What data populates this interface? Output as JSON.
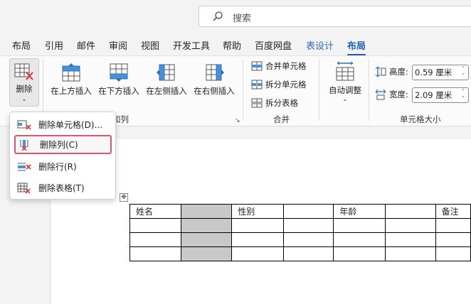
{
  "search": {
    "placeholder": "搜索"
  },
  "tabs": [
    {
      "label": "布局"
    },
    {
      "label": "引用"
    },
    {
      "label": "邮件"
    },
    {
      "label": "审阅"
    },
    {
      "label": "视图"
    },
    {
      "label": "开发工具"
    },
    {
      "label": "帮助"
    },
    {
      "label": "百度网盘"
    },
    {
      "label": "表设计"
    },
    {
      "label": "布局"
    }
  ],
  "ribbon": {
    "delete_label": "删除",
    "insert_above": "在上方插入",
    "insert_below": "在下方插入",
    "insert_left": "在左侧插入",
    "insert_right": "在右侧插入",
    "rows_cols_group_partial": "和列",
    "merge_cells": "合并单元格",
    "split_cells": "拆分单元格",
    "split_table": "拆分表格",
    "merge_group": "合并",
    "autofit": "自动调整",
    "height_label": "高度:",
    "height_value": "0.59 厘米",
    "width_label": "宽度:",
    "width_value": "2.09 厘米",
    "cellsize_group": "单元格大小"
  },
  "menu": {
    "items": [
      {
        "label": "删除单元格(D)..."
      },
      {
        "label": "删除列(C)"
      },
      {
        "label": "删除行(R)"
      },
      {
        "label": "删除表格(T)"
      }
    ]
  },
  "table": {
    "header": [
      "姓名",
      "",
      "性别",
      "",
      "年龄",
      "",
      "备注"
    ]
  },
  "colors": {
    "accent": "#1f5fb5",
    "highlight_border": "#e0566b",
    "selected_column": "#c8c8c8"
  }
}
